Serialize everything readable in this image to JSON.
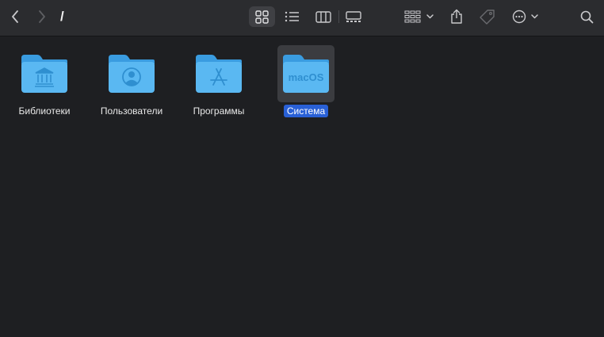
{
  "toolbar": {
    "path_title": "/",
    "icons": {
      "back": "chevron-left-icon",
      "forward": "chevron-right-icon",
      "icon_view": "grid-icon",
      "list_view": "list-icon",
      "column_view": "columns-icon",
      "gallery_view": "gallery-icon",
      "group": "group-grid-icon",
      "share": "share-icon",
      "tag": "tag-icon",
      "action": "ellipsis-circle-icon",
      "search": "magnifier-icon"
    }
  },
  "items": [
    {
      "label": "Библиотеки",
      "icon": "library-folder-icon",
      "selected": false
    },
    {
      "label": "Пользователи",
      "icon": "users-folder-icon",
      "selected": false
    },
    {
      "label": "Программы",
      "icon": "applications-folder-icon",
      "selected": false
    },
    {
      "label": "Система",
      "icon": "system-folder-icon",
      "badge": "macOS",
      "selected": true
    }
  ],
  "colors": {
    "folder_body": "#5ab8f2",
    "folder_tab": "#3a9ce0",
    "selection": "#2960d6"
  }
}
